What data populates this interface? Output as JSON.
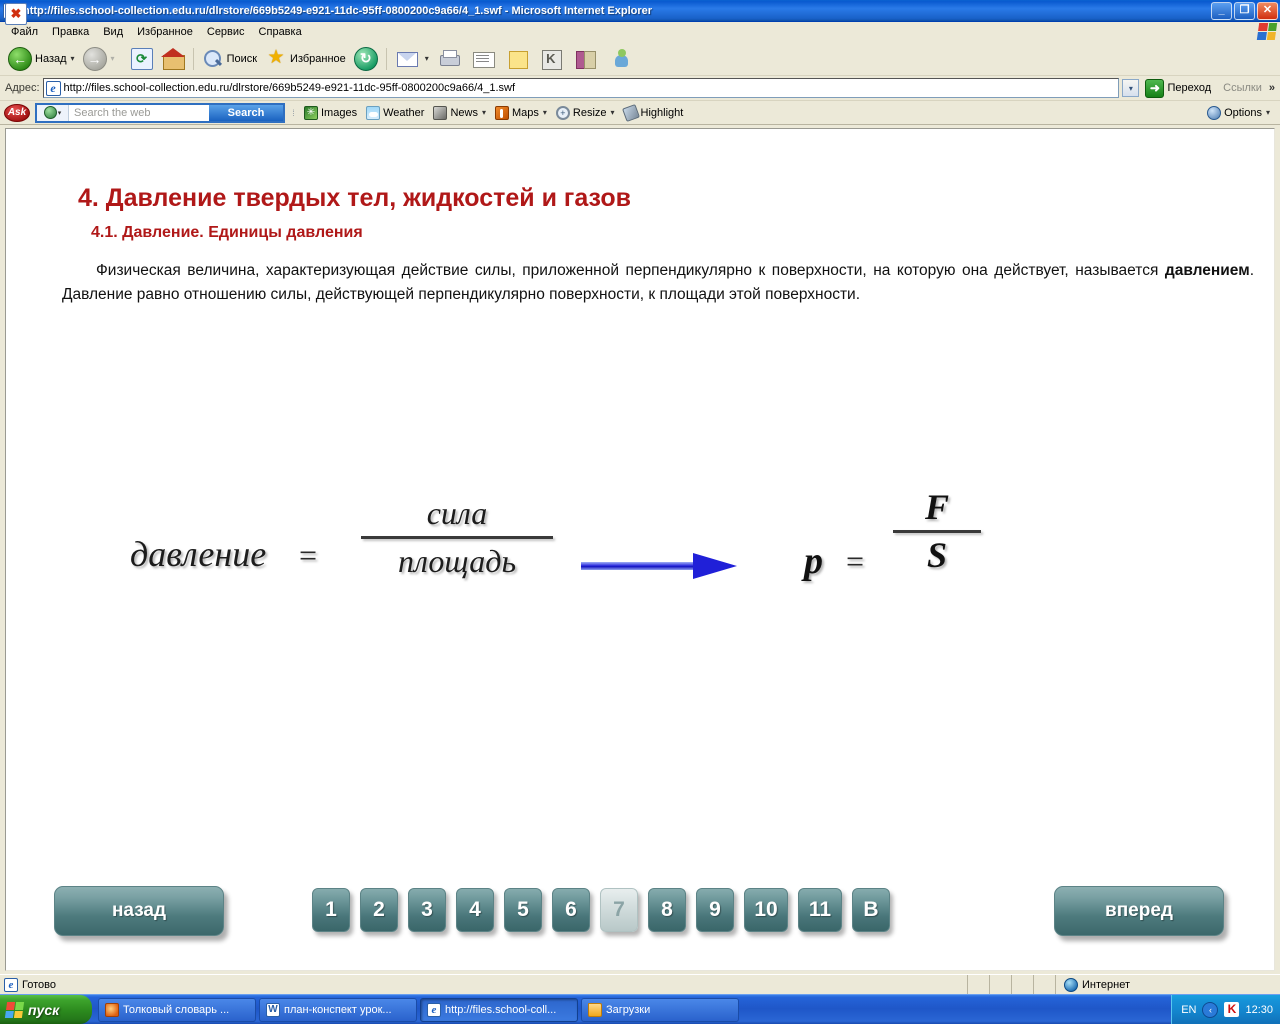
{
  "window": {
    "title": "http://files.school-collection.edu.ru/dlrstore/669b5249-e921-11dc-95ff-0800200c9a66/4_1.swf - Microsoft Internet Explorer",
    "minimize_label": "_",
    "restore_label": "❐",
    "close_label": "✕"
  },
  "menu": {
    "items": [
      "Файл",
      "Правка",
      "Вид",
      "Избранное",
      "Сервис",
      "Справка"
    ]
  },
  "toolbar": {
    "back_label": "Назад",
    "forward_label": "",
    "stop_label": "✖",
    "refresh_label": "⟳",
    "home_label": "",
    "search_label": "Поиск",
    "favorites_label": "Избранное",
    "history_label": "",
    "mail_label": "",
    "print_label": "",
    "edit_label": "",
    "note_label": "",
    "kaspersky_label": "",
    "research_label": "",
    "messenger_label": ""
  },
  "address": {
    "label": "Адрес:",
    "url": "http://files.school-collection.edu.ru/dlrstore/669b5249-e921-11dc-95ff-0800200c9a66/4_1.swf",
    "dropdown_glyph": "▾",
    "go_label": "Переход",
    "go_glyph": "➜",
    "links_label": "Ссылки",
    "overflow_glyph": "»"
  },
  "ask_toolbar": {
    "brand": "Ask",
    "search_placeholder": "Search the web",
    "search_value": "",
    "search_button": "Search",
    "items": [
      {
        "label": "Images",
        "icon": "images-icon",
        "caret": false
      },
      {
        "label": "Weather",
        "icon": "weather-icon",
        "caret": false
      },
      {
        "label": "News",
        "icon": "news-icon",
        "caret": true
      },
      {
        "label": "Maps",
        "icon": "maps-icon",
        "caret": true
      },
      {
        "label": "Resize",
        "icon": "resize-icon",
        "caret": true
      },
      {
        "label": "Highlight",
        "icon": "highlight-icon",
        "caret": false
      }
    ],
    "options_label": "Options",
    "options_caret": "▾"
  },
  "content": {
    "heading": "4. Давление твердых тел, жидкостей и газов",
    "subheading": "4.1. Давление. Единицы давления",
    "paragraph_part1": "Физическая величина, характеризующая действие силы, приложенной перпендикулярно к поверхности, на которую она действует, называется ",
    "paragraph_bold": "давлением",
    "paragraph_part2": ". Давление равно отношению силы, действующей перпендикулярно поверхности, к площади этой поверхности.",
    "formula": {
      "word_left": "давление",
      "equals1": "=",
      "numerator_word": "сила",
      "denominator_word": "площадь",
      "arrow_color": "#2020d8",
      "symbol_p": "p",
      "equals2": "=",
      "numerator_symbol": "F",
      "denominator_symbol": "S"
    },
    "nav": {
      "back_label": "назад",
      "forward_label": "вперед",
      "pages": [
        "1",
        "2",
        "3",
        "4",
        "5",
        "6",
        "7",
        "8",
        "9",
        "10",
        "11",
        "B"
      ],
      "active_page": "7"
    }
  },
  "statusbar": {
    "text": "Готово",
    "zone": "Интернет"
  },
  "taskbar": {
    "start_label": "пуск",
    "tasks": [
      {
        "label": "Толковый словарь ...",
        "icon": "firefox-icon",
        "active": false
      },
      {
        "label": "план-конспект урок...",
        "icon": "word-icon",
        "active": false
      },
      {
        "label": "http://files.school-coll...",
        "icon": "ie-icon",
        "active": true
      },
      {
        "label": "Загрузки",
        "icon": "folder-icon",
        "active": false
      }
    ],
    "language": "EN",
    "tray_arrow": "‹",
    "kaspersky": "K",
    "clock": "12:30"
  }
}
